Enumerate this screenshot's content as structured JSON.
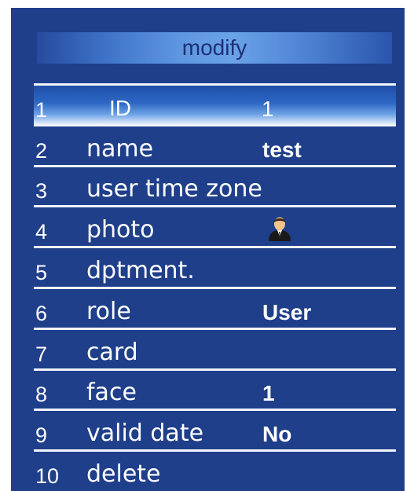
{
  "title": "modify",
  "rows": [
    {
      "num": "1",
      "label": "ID",
      "value": "1"
    },
    {
      "num": "2",
      "label": "name",
      "value": "test"
    },
    {
      "num": "3",
      "label": "user time zone",
      "value": ""
    },
    {
      "num": "4",
      "label": "photo",
      "value": "",
      "icon": "user-photo-icon"
    },
    {
      "num": "5",
      "label": "dptment.",
      "value": ""
    },
    {
      "num": "6",
      "label": "role",
      "value": "User"
    },
    {
      "num": "7",
      "label": "card",
      "value": ""
    },
    {
      "num": "8",
      "label": "face",
      "value": "1"
    },
    {
      "num": "9",
      "label": "valid date",
      "value": "No"
    },
    {
      "num": "10",
      "label": "delete",
      "value": ""
    }
  ],
  "selected_row": "1",
  "colors": {
    "background": "#1f3f8a",
    "separator": "#f2f4fa",
    "title_text": "#1c3274"
  }
}
